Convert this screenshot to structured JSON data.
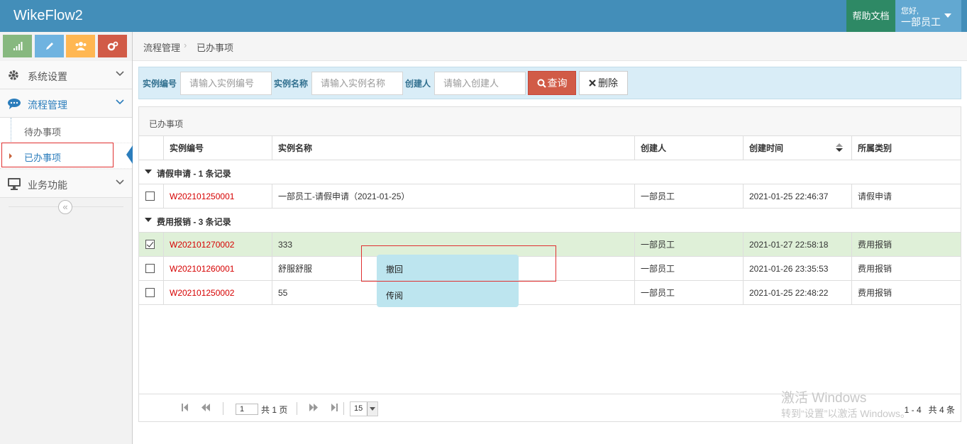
{
  "app": {
    "title": "WikeFlow2"
  },
  "header": {
    "help_label": "帮助文档",
    "greeting": "您好,",
    "user_name": "一部员工"
  },
  "sidebar": {
    "shortcuts": [
      "signal-icon",
      "pencil-icon",
      "users-icon",
      "cogs-icon"
    ],
    "items": [
      {
        "label": "系统设置",
        "icon": "gear-icon"
      },
      {
        "label": "流程管理",
        "icon": "comments-icon",
        "open": true,
        "children": [
          {
            "label": "待办事项"
          },
          {
            "label": "已办事项",
            "active": true
          }
        ]
      },
      {
        "label": "业务功能",
        "icon": "desktop-icon"
      }
    ],
    "collapse_symbol": "«"
  },
  "breadcrumb": {
    "root": "流程管理",
    "current": "已办事项"
  },
  "search": {
    "id_label": "实例编号",
    "id_placeholder": "请输入实例编号",
    "name_label": "实例名称",
    "name_placeholder": "请输入实例名称",
    "creator_label": "创建人",
    "creator_placeholder": "请输入创建人",
    "query_label": "查询",
    "delete_label": "删除"
  },
  "grid": {
    "title": "已办事项",
    "columns": [
      "实例编号",
      "实例名称",
      "创建人",
      "创建时间",
      "所属类别"
    ],
    "groups": [
      {
        "label": "请假申请 - 1 条记录",
        "rows": [
          {
            "id": "W202101250001",
            "name": "一部员工-请假申请（2021-01-25）",
            "creator": "一部员工",
            "time": "2021-01-25 22:46:37",
            "category": "请假申请",
            "checked": false
          }
        ]
      },
      {
        "label": "费用报销 - 3 条记录",
        "rows": [
          {
            "id": "W202101270002",
            "name": "333",
            "creator": "一部员工",
            "time": "2021-01-27 22:58:18",
            "category": "费用报销",
            "checked": true
          },
          {
            "id": "W202101260001",
            "name": "舒服舒服",
            "creator": "一部员工",
            "time": "2021-01-26 23:35:53",
            "category": "费用报销",
            "checked": false
          },
          {
            "id": "W202101250002",
            "name": "55",
            "creator": "一部员工",
            "time": "2021-01-25 22:48:22",
            "category": "费用报销",
            "checked": false
          }
        ]
      }
    ]
  },
  "context_menu": {
    "items": [
      "撤回",
      "传阅"
    ]
  },
  "pager": {
    "page": "1",
    "total_pages_text": "共 1 页",
    "page_size": "15",
    "range": "1 - 4",
    "total_text": "共 4 条"
  },
  "watermark": {
    "line1": "激活 Windows",
    "line2": "转到“设置”以激活 Windows。"
  },
  "colors": {
    "brand": "#438eb9",
    "danger": "#d15b47",
    "selected_row": "#dff0d8",
    "menu_bg": "#bde5ef"
  }
}
